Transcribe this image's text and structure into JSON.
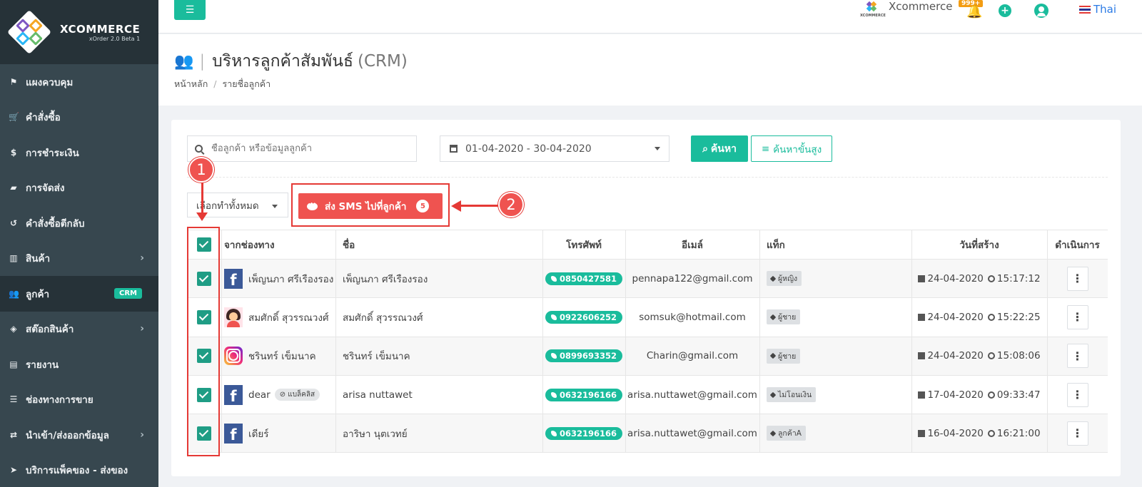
{
  "brand": {
    "name": "XCOMMERCE",
    "version": "xOrder 2.0 Beta 1"
  },
  "sidebar": {
    "items": [
      {
        "label": "แผงควบคุม",
        "icon": "flag-icon",
        "glyph": "⚑"
      },
      {
        "label": "คำสั่งซื้อ",
        "icon": "cart-icon",
        "glyph": "🛒"
      },
      {
        "label": "การชำระเงิน",
        "icon": "dollar-icon",
        "glyph": "$"
      },
      {
        "label": "การจัดส่ง",
        "icon": "truck-icon",
        "glyph": "▰"
      },
      {
        "label": "คำสั่งซื้อตีกลับ",
        "icon": "undo-icon",
        "glyph": "↺"
      },
      {
        "label": "สินค้า",
        "icon": "barcode-icon",
        "glyph": "▥"
      },
      {
        "label": "ลูกค้า",
        "icon": "users-icon",
        "glyph": "👥",
        "badge": "CRM"
      },
      {
        "label": "สต๊อกสินค้า",
        "icon": "cubes-icon",
        "glyph": "◈"
      },
      {
        "label": "รายงาน",
        "icon": "bar-chart-icon",
        "glyph": "▤"
      },
      {
        "label": "ช่องทางการขาย",
        "icon": "list-icon",
        "glyph": "☰"
      },
      {
        "label": "นำเข้า/ส่งออกข้อมูล",
        "icon": "exchange-icon",
        "glyph": "⇄"
      },
      {
        "label": "บริการแพ็คของ - ส่งของ",
        "icon": "send-icon",
        "glyph": "➤"
      }
    ],
    "active_index": 6
  },
  "topbar": {
    "store_name": "Xcommerce",
    "store_logo_text": "XCOMMERCE",
    "notification_count": "999+",
    "language": "Thai"
  },
  "page": {
    "title": "บริหารลูกค้าสัมพันธ์",
    "title_suffix": "(CRM)",
    "breadcrumb": [
      "หน้าหลัก",
      "รายชื่อลูกค้า"
    ]
  },
  "filters": {
    "search_placeholder": "ชื่อลูกค้า หรือข้อมูลลูกค้า",
    "date_range": "01-04-2020 - 30-04-2020",
    "search_button": "ค้นหา",
    "advanced_button": "ค้นหาขั้นสูง",
    "bulk_action": "เลือกทำทั้งหมด",
    "sms_button": "ส่ง SMS ไปที่ลูกค้า",
    "sms_count": "5"
  },
  "table": {
    "columns": [
      "จากช่องทาง",
      "ชื่อ",
      "โทรศัพท์",
      "อีเมล์",
      "แท็ก",
      "วันที่สร้าง",
      "ดำเนินการ"
    ],
    "rows": [
      {
        "channel": "facebook",
        "channel_name": "เพ็ญนภา ศรีเรืองรอง",
        "name": "เพ็ญนภา ศรีเรืองรอง",
        "phone": "0850427581",
        "email": "pennapa122@gmail.com",
        "tag": "ผู้หญิง",
        "date": "24-04-2020",
        "time": "15:17:12",
        "checked": true
      },
      {
        "channel": "avatar",
        "channel_name": "สมศักดิ์ สุวรรณวงศ์",
        "name": "สมศักดิ์ สุวรรณวงศ์",
        "phone": "0922606252",
        "email": "somsuk@hotmail.com",
        "tag": "ผู้ชาย",
        "date": "24-04-2020",
        "time": "15:22:25",
        "checked": true
      },
      {
        "channel": "instagram",
        "channel_name": "ชรินทร์ เข็มนาค",
        "name": "ชรินทร์ เข็มนาค",
        "phone": "0899693352",
        "email": "Charin@gmail.com",
        "tag": "ผู้ชาย",
        "date": "24-04-2020",
        "time": "15:08:06",
        "checked": true
      },
      {
        "channel": "facebook",
        "channel_name": "dear",
        "blacklist": "แบล็คลิส",
        "name": "arisa nuttawet",
        "phone": "0632196166",
        "email": "arisa.nuttawet@gmail.com",
        "tag": "ไม่โอนเงิน",
        "date": "17-04-2020",
        "time": "09:33:47",
        "checked": true
      },
      {
        "channel": "facebook",
        "channel_name": "เดียร์",
        "name": "อาริษา นุตเวทย์",
        "phone": "0632196166",
        "email": "arisa.nuttawet@gmail.com",
        "tag": "ลูกค้าA",
        "date": "16-04-2020",
        "time": "16:21:00",
        "checked": true
      }
    ]
  },
  "annotations": {
    "step1": "1",
    "step2": "2"
  },
  "colors": {
    "accent": "#1abc9c",
    "sidebar": "#37474f",
    "danger": "#ef5350",
    "annotation": "#e53935"
  }
}
